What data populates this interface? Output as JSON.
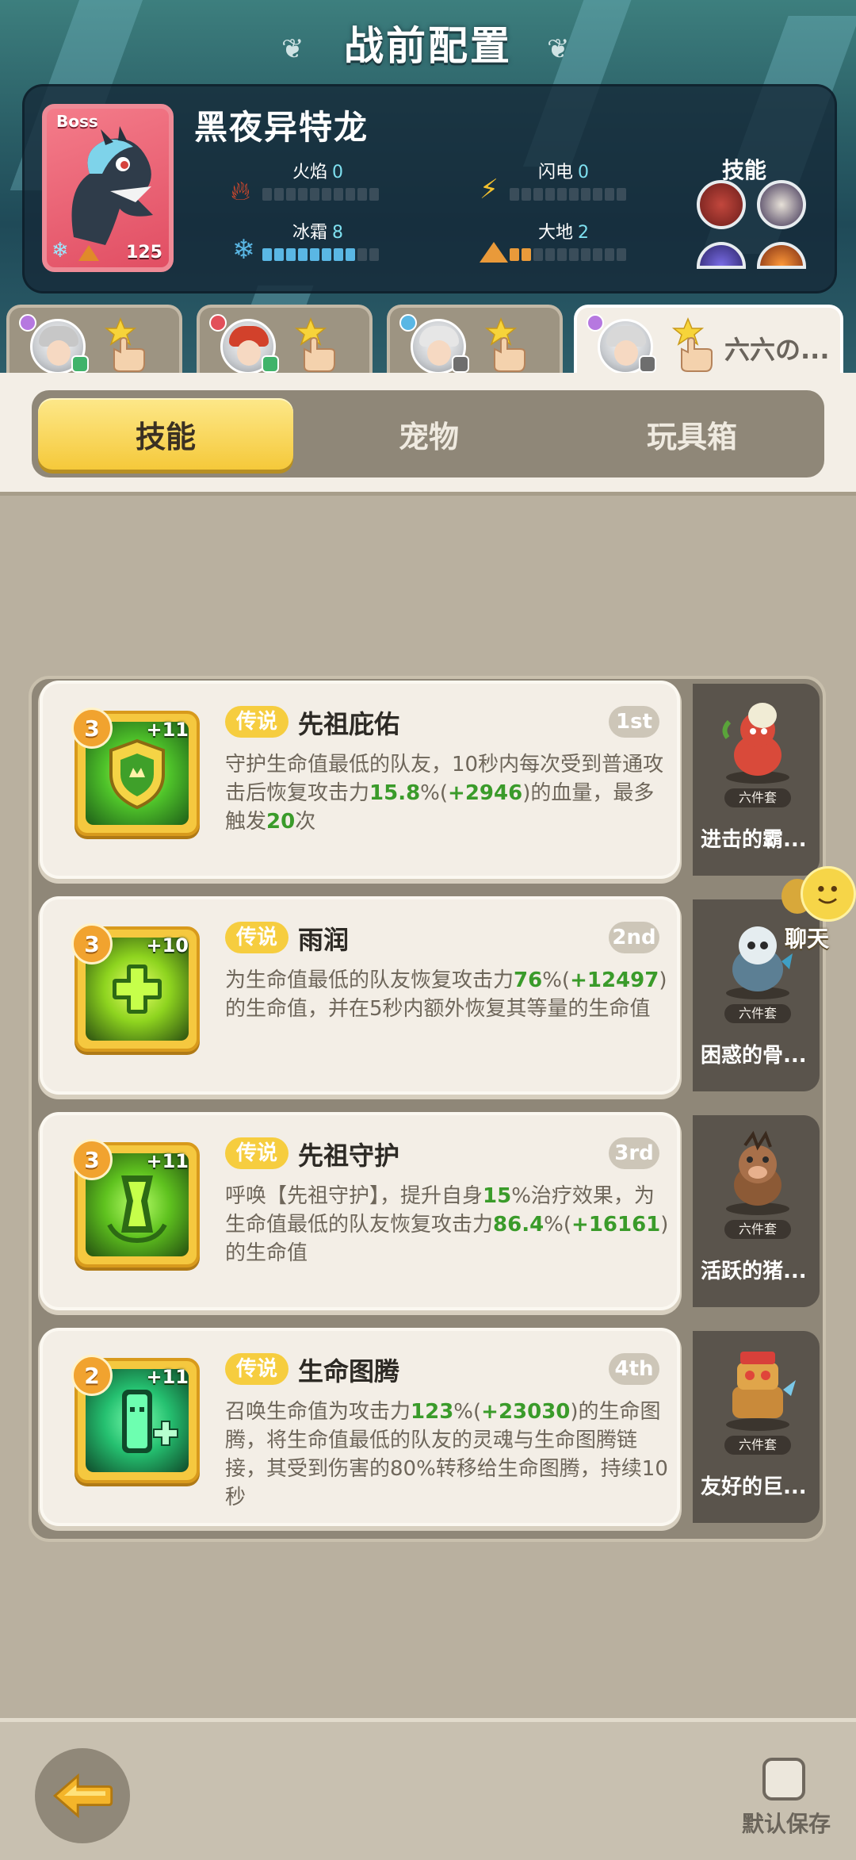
{
  "header": {
    "title": "战前配置"
  },
  "boss": {
    "tag": "Boss",
    "name": "黑夜异特龙",
    "level": "125",
    "elements": [
      {
        "label": "火焰",
        "value": "0",
        "icon": "fire-icon",
        "color": "#e84a2a",
        "filled": 0
      },
      {
        "label": "闪电",
        "value": "0",
        "icon": "lightning-icon",
        "color": "#f3c12e",
        "filled": 0
      },
      {
        "label": "冰霜",
        "value": "8",
        "icon": "ice-icon",
        "color": "#5ab7e4",
        "filled": 8
      },
      {
        "label": "大地",
        "value": "2",
        "icon": "earth-icon",
        "color": "#e99a3a",
        "filled": 2
      }
    ],
    "skills_label": "技能"
  },
  "hero_tabs": [
    {
      "element": "purple",
      "badge": "green",
      "hair": "#c7c7c7"
    },
    {
      "element": "red",
      "badge": "green",
      "hair": "#d2412b"
    },
    {
      "element": "blue",
      "badge": "gray",
      "hair": "#e6e6e6"
    },
    {
      "element": "purple",
      "badge": "gray",
      "hair": "#d8d8d8",
      "name": "六六の..."
    }
  ],
  "tabs": [
    {
      "label": "技能",
      "active": true
    },
    {
      "label": "宠物",
      "active": false
    },
    {
      "label": "玩具箱",
      "active": false
    }
  ],
  "skills": [
    {
      "stars": "3",
      "plus": "+11",
      "rarity": "传说",
      "title": "先祖庇佑",
      "rank": "1st",
      "desc": [
        {
          "t": "守护生命值最低的队友，10秒内每次受到普通攻击后恢复攻击力"
        },
        {
          "t": "15.8",
          "g": true
        },
        {
          "t": "%("
        },
        {
          "t": "+2946",
          "g": true
        },
        {
          "t": ")的血量，最多触发"
        },
        {
          "t": "20",
          "g": true
        },
        {
          "t": "次"
        }
      ],
      "pet": {
        "name": "进击的霸...",
        "set": "六件套"
      }
    },
    {
      "stars": "3",
      "plus": "+10",
      "rarity": "传说",
      "title": "雨润",
      "rank": "2nd",
      "desc": [
        {
          "t": "为生命值最低的队友恢复攻击力"
        },
        {
          "t": "76",
          "g": true
        },
        {
          "t": "%("
        },
        {
          "t": "+12497",
          "g": true
        },
        {
          "t": ")的生命值，并在5秒内额外恢复其等量的生命值"
        }
      ],
      "pet": {
        "name": "困惑的骨...",
        "set": "六件套"
      }
    },
    {
      "stars": "3",
      "plus": "+11",
      "rarity": "传说",
      "title": "先祖守护",
      "rank": "3rd",
      "desc": [
        {
          "t": "呼唤【先祖守护】，提升自身"
        },
        {
          "t": "15",
          "g": true
        },
        {
          "t": "%治疗效果，为生命值最低的队友恢复攻击力"
        },
        {
          "t": "86.4",
          "g": true
        },
        {
          "t": "%("
        },
        {
          "t": "+16161",
          "g": true
        },
        {
          "t": ")的生命值"
        }
      ],
      "pet": {
        "name": "活跃的猪...",
        "set": "六件套"
      }
    },
    {
      "stars": "2",
      "plus": "+11",
      "rarity": "传说",
      "title": "生命图腾",
      "rank": "4th",
      "desc": [
        {
          "t": "召唤生命值为攻击力"
        },
        {
          "t": "123",
          "g": true
        },
        {
          "t": "%("
        },
        {
          "t": "+23030",
          "g": true
        },
        {
          "t": ")的生命图腾，将生命值最低的队友的灵魂与生命图腾链接，其受到伤害的80%转移给生命图腾，持续10秒"
        }
      ],
      "pet": {
        "name": "友好的巨...",
        "set": "六件套"
      }
    }
  ],
  "chat": {
    "label": "聊天"
  },
  "footer": {
    "save_label": "默认保存"
  }
}
